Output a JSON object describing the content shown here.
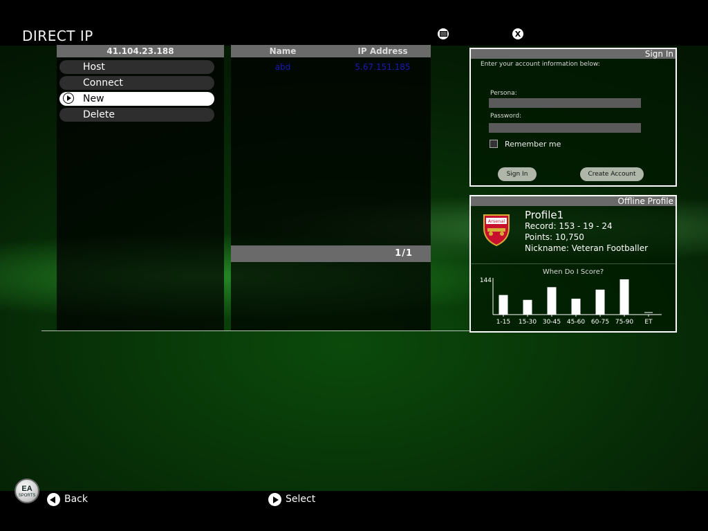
{
  "header": {
    "title": "DIRECT IP"
  },
  "top_icons": [
    {
      "name": "menu-icon",
      "glyph": ""
    },
    {
      "name": "close-icon",
      "glyph": "X"
    }
  ],
  "ip_list": {
    "header": "41.104.23.188",
    "items": [
      {
        "label": "Host",
        "selected": false
      },
      {
        "label": "Connect",
        "selected": false
      },
      {
        "label": "New",
        "selected": true
      },
      {
        "label": "Delete",
        "selected": false
      }
    ]
  },
  "server_table": {
    "columns": [
      "Name",
      "IP Address"
    ],
    "rows": [
      {
        "name": "abd",
        "ip": "5.67.151.185"
      }
    ],
    "pagination": "1/1"
  },
  "sign_in": {
    "title": "Sign In",
    "instructions": "Enter your account information below:",
    "persona_label": "Persona:",
    "persona_value": "",
    "password_label": "Password:",
    "password_value": "",
    "remember_label": "Remember me",
    "remember_checked": false,
    "sign_in_button": "Sign In",
    "create_account_button": "Create Account"
  },
  "profile": {
    "title": "Offline Profile",
    "crest_text": "Arsenal",
    "name": "Profile1",
    "record": "Record: 153 - 19 - 24",
    "points": "Points: 10,750",
    "nickname": "Nickname: Veteran Footballer"
  },
  "chart_data": {
    "type": "bar",
    "title": "When Do I Score?",
    "categories": [
      "1-15",
      "15-30",
      "30-45",
      "45-60",
      "60-75",
      "75-90",
      "ET"
    ],
    "values": [
      80,
      60,
      112,
      65,
      102,
      144,
      0
    ],
    "ymax_label": "144",
    "ylim": [
      0,
      144
    ],
    "color": "#ffffff"
  },
  "footer": {
    "logo_text": "EA",
    "logo_sub": "SPORTS",
    "back_label": "Back",
    "select_label": "Select"
  },
  "colors": {
    "accent": "#0b4a0b",
    "header_gray": "#6a6a6a",
    "link_blue": "#1a1ab0"
  }
}
